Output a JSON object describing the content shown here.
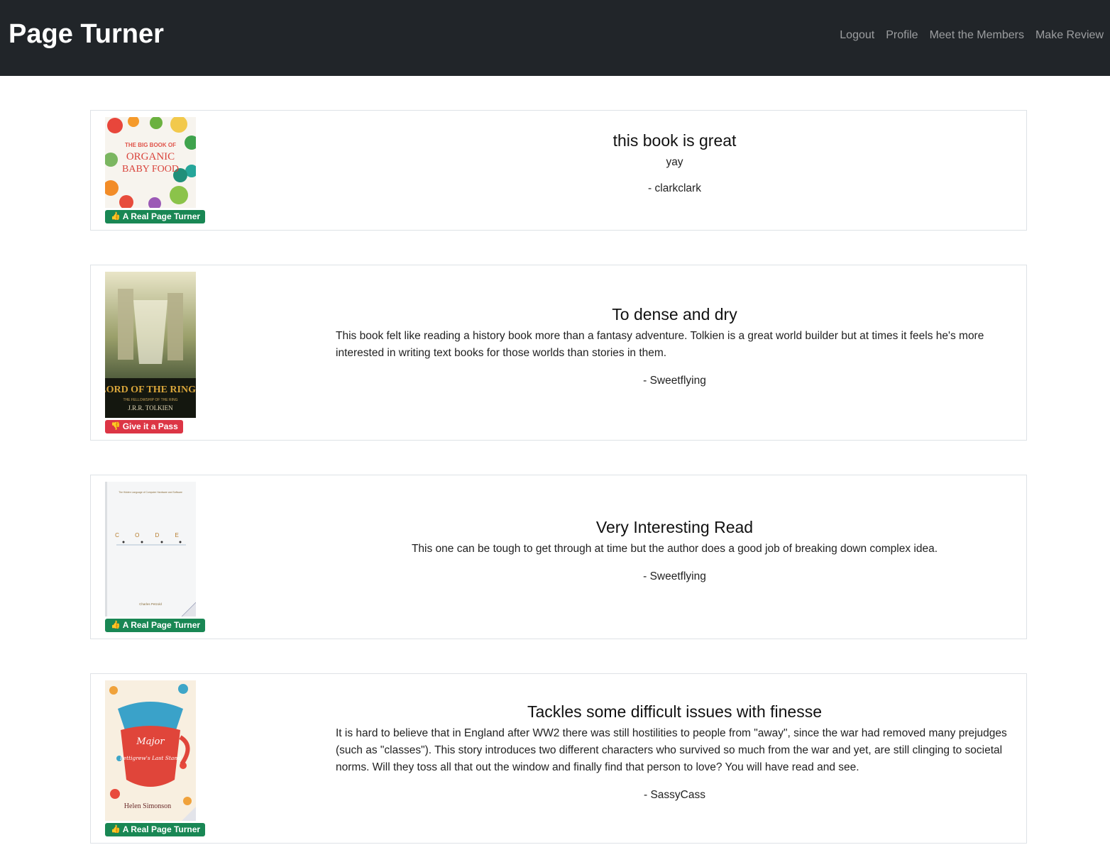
{
  "app": {
    "brand": "Page Turner"
  },
  "nav": {
    "logout": "Logout",
    "profile": "Profile",
    "members": "Meet the Members",
    "make_review": "Make Review"
  },
  "reviews": [
    {
      "title": "this book is great",
      "body": "yay",
      "author": "- clarkclark",
      "badge": "A Real Page Turner",
      "verdict": "good",
      "cover": {
        "icon": "organic-baby-food-cover",
        "line1": "THE BIG BOOK OF",
        "line2": "ORGANIC",
        "line3": "BABY FOOD"
      }
    },
    {
      "title": "To dense and dry",
      "body": "This book felt like reading a history book more than a fantasy adventure. Tolkien is a great world builder but at times it feels he's more interested in writing text books for those worlds than stories in them.",
      "author": "- Sweetflying",
      "badge": "Give it a Pass",
      "verdict": "bad",
      "cover": {
        "icon": "lord-of-the-rings-cover",
        "line1": "LORD OF THE RINGS",
        "line2": "THE FELLOWSHIP OF THE RING",
        "line3": "J.R.R. TOLKIEN"
      }
    },
    {
      "title": "Very Interesting Read",
      "body": "This one can be tough to get through at time but the author does a good job of breaking down complex idea.",
      "author": "- Sweetflying",
      "badge": "A Real Page Turner",
      "verdict": "good",
      "cover": {
        "icon": "code-book-cover",
        "line1": "The Hidden Language of Computer Hardware and Software",
        "line2": "C O D E",
        "line3": "Charles Petzold"
      }
    },
    {
      "title": "Tackles some difficult issues with finesse",
      "body": "It is hard to believe that in England after WW2 there was still hostilities to people from \"away\", since the war had removed many prejudges (such as \"classes\"). This story introduces two different characters who survived so much from the war and yet, are still clinging to societal norms. Will they toss all that out the window and finally find that person to love? You will have read and see.",
      "author": "- SassyCass",
      "badge": "A Real Page Turner",
      "verdict": "good",
      "cover": {
        "icon": "major-pettigrew-cover",
        "line1": "Major",
        "line2": "Pettigrew's Last Stand",
        "line3": "Helen Simonson"
      }
    }
  ],
  "colors": {
    "navbar": "#212529",
    "good": "#198754",
    "bad": "#dc3545"
  }
}
